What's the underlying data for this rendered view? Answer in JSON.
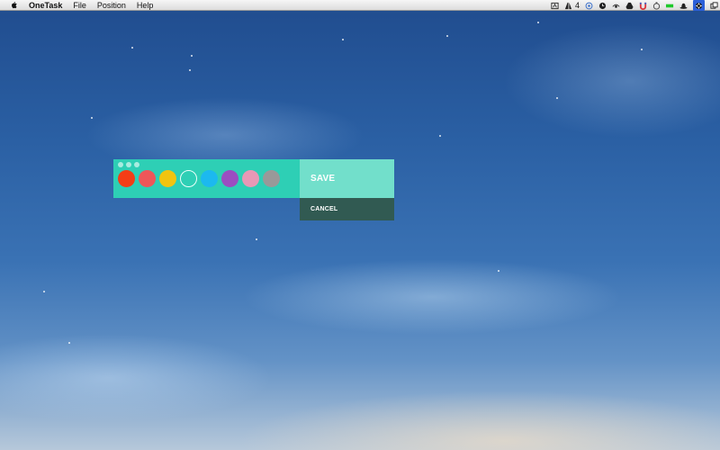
{
  "menubar": {
    "apple_icon": "apple-logo-icon",
    "app_name": "OneTask",
    "items": [
      {
        "label": "File"
      },
      {
        "label": "Position"
      },
      {
        "label": "Help"
      }
    ],
    "status_icons": [
      {
        "name": "screen-capture-icon"
      },
      {
        "name": "adobe-icon",
        "count": "4"
      },
      {
        "name": "sync-icon"
      },
      {
        "name": "clock-icon"
      },
      {
        "name": "eye-icon"
      },
      {
        "name": "drive-icon"
      },
      {
        "name": "magnet-icon"
      },
      {
        "name": "timer-icon"
      },
      {
        "name": "battery-icon"
      },
      {
        "name": "hat-icon"
      },
      {
        "name": "aperture-icon"
      },
      {
        "name": "window-icon"
      }
    ]
  },
  "widget": {
    "window_controls": [
      "close",
      "minimize",
      "zoom"
    ],
    "colors": [
      {
        "name": "red",
        "hex": "#f43d16",
        "selected": false
      },
      {
        "name": "salmon",
        "hex": "#ef5659",
        "selected": false
      },
      {
        "name": "yellow",
        "hex": "#f1c40f",
        "selected": false
      },
      {
        "name": "teal",
        "hex": "#2ecfb5",
        "selected": true
      },
      {
        "name": "sky-blue",
        "hex": "#1cb9ef",
        "selected": false
      },
      {
        "name": "purple",
        "hex": "#9b4ec1",
        "selected": false
      },
      {
        "name": "pink",
        "hex": "#e898b6",
        "selected": false
      },
      {
        "name": "gray",
        "hex": "#999999",
        "selected": false
      }
    ],
    "background": "#2ecfb5"
  },
  "actions": {
    "save_label": "SAVE",
    "cancel_label": "CANCEL",
    "save_color": "#72dfcb",
    "cancel_color": "#315a52"
  }
}
